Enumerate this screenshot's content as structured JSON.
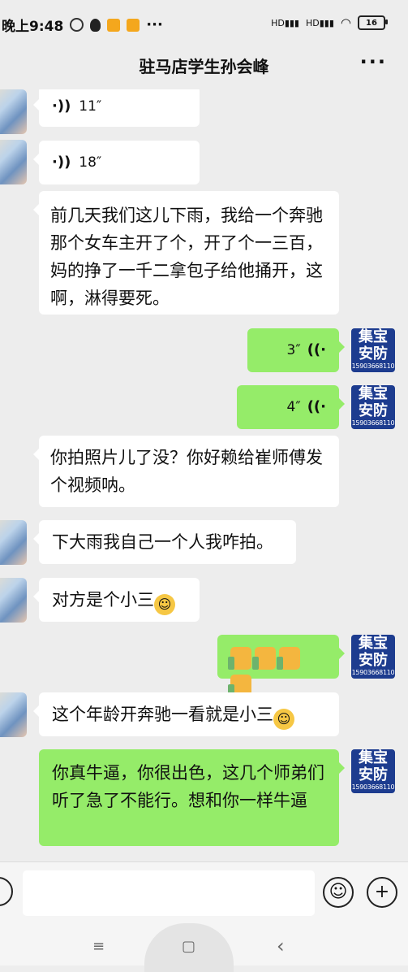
{
  "status": {
    "time": "晚上9:48",
    "network": "HD",
    "battery": "16"
  },
  "header": {
    "title": "驻马店学生孙会峰",
    "more": "···"
  },
  "avatar_right": {
    "line1": "集宝",
    "line2": "安防",
    "phone": "15903668110"
  },
  "messages": [
    {
      "side": "in",
      "type": "voice",
      "duration": "11″"
    },
    {
      "side": "in",
      "type": "voice",
      "duration": "18″"
    },
    {
      "side": "in",
      "type": "text",
      "text": "前几天我们这儿下雨，我给一个奔驰那个女车主开了个，开了个一三百，妈的挣了一千二拿包子给他捅开，这啊，淋得要死。"
    },
    {
      "side": "out",
      "type": "voice",
      "duration": "3″"
    },
    {
      "side": "out",
      "type": "voice",
      "duration": "4″"
    },
    {
      "side": "in",
      "type": "text",
      "text": "你拍照片儿了没？你好赖给崔师傅发个视频呐。"
    },
    {
      "side": "in",
      "type": "text",
      "text": "下大雨我自己一个人我咋拍。"
    },
    {
      "side": "in",
      "type": "text",
      "text": "对方是个小三"
    },
    {
      "side": "out",
      "type": "emoji",
      "text": "thumbs-up x4"
    },
    {
      "side": "in",
      "type": "text",
      "text": "这个年龄开奔驰一看就是小三"
    },
    {
      "side": "out",
      "type": "text",
      "text": "你真牛逼，你很出色，这几个师弟们听了急了不能行。想和你一样牛逼"
    }
  ],
  "input": {
    "placeholder": ""
  },
  "icons": {
    "emoji_button": "smiley-icon",
    "plus_button": "plus-icon",
    "voice_button": "voice-toggle-icon"
  },
  "nav": {
    "menu": "≡",
    "home": "▢",
    "back": "‹"
  }
}
